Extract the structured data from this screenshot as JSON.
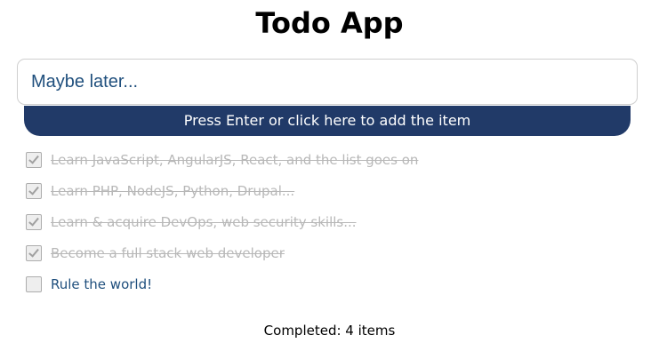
{
  "app": {
    "title": "Todo App"
  },
  "new_item": {
    "placeholder": "Maybe later...",
    "value": ""
  },
  "add_button": {
    "label": "Press Enter or click here to add the item"
  },
  "todos": [
    {
      "text": "Learn JavaScript, AngularJS, React, and the list goes on",
      "completed": true
    },
    {
      "text": "Learn PHP, NodeJS, Python, Drupal...",
      "completed": true
    },
    {
      "text": "Learn & acquire DevOps, web security skills...",
      "completed": true
    },
    {
      "text": "Become a full stack web developer",
      "completed": true
    },
    {
      "text": "Rule the world!",
      "completed": false
    }
  ],
  "summary": {
    "completed_text": "Completed: 4 items"
  },
  "colors": {
    "button_bg": "#213a68",
    "open_text": "#1f4f7d",
    "done_text": "#b8b8b8"
  }
}
